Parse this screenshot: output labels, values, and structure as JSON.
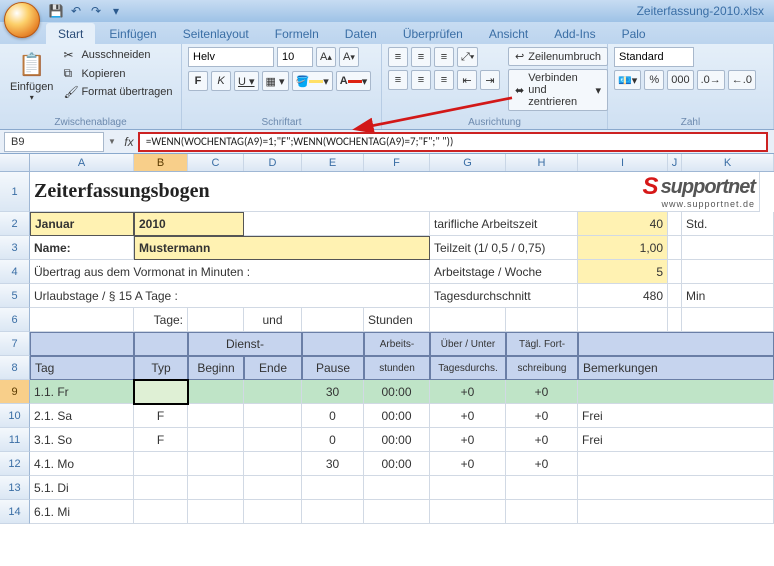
{
  "app": {
    "filename": "Zeiterfassung-2010.xlsx"
  },
  "qat": {
    "save": "save",
    "undo": "undo",
    "redo": "redo"
  },
  "tabs": [
    "Start",
    "Einfügen",
    "Seitenlayout",
    "Formeln",
    "Daten",
    "Überprüfen",
    "Ansicht",
    "Add-Ins",
    "Palo"
  ],
  "ribbon": {
    "paste": "Einfügen",
    "cut": "Ausschneiden",
    "copy": "Kopieren",
    "formatpainter": "Format übertragen",
    "g_clipboard": "Zwischenablage",
    "font_name": "Helv",
    "font_size": "10",
    "g_font": "Schriftart",
    "wrap": "Zeilenumbruch",
    "merge": "Verbinden und zentrieren",
    "g_align": "Ausrichtung",
    "num_format": "Standard",
    "g_number": "Zahl"
  },
  "fbar": {
    "namebox": "B9",
    "formula": "=WENN(WOCHENTAG(A9)=1;\"F\";WENN(WOCHENTAG(A9)=7;\"F\";\" \"))"
  },
  "cols": [
    "A",
    "B",
    "C",
    "D",
    "E",
    "F",
    "G",
    "H",
    "I",
    "J",
    "K"
  ],
  "sheet": {
    "title": "Zeiterfassungsbogen",
    "logo": {
      "word": "supportnet",
      "sub": "www.supportnet.de"
    },
    "month": "Januar",
    "year": "2010",
    "name_label": "Name:",
    "name_value": "Mustermann",
    "tarif_label": "tarifliche Arbeitszeit",
    "tarif_val": "40",
    "tarif_unit": "Std.",
    "teil_label": "Teilzeit (1/ 0,5 / 0,75)",
    "teil_val": "1,00",
    "carry_label": "Übertrag aus dem Vormonat in Minuten :",
    "arbtage_label": "Arbeitstage / Woche",
    "arbtage_val": "5",
    "urlaub_label": "Urlaubstage / § 15 A Tage :",
    "durch_label": "Tagesdurchschnitt",
    "durch_val": "480",
    "durch_unit": "Min",
    "tage_label": "Tage:",
    "und_label": "und",
    "stunden_label": "Stunden",
    "hdr": {
      "tag": "Tag",
      "typ": "Typ",
      "dienst": "Dienst-",
      "beginn": "Beginn",
      "ende": "Ende",
      "pause": "Pause",
      "arbeits": "Arbeits-",
      "stunden": "stunden",
      "ueber": "Über / Unter",
      "tagesd": "Tagesdurchs.",
      "taegl": "Tägl. Fort-",
      "schreib": "schreibung",
      "bem": "Bemerkungen"
    },
    "rows": [
      {
        "n": 9,
        "tag": "1.1. Fr",
        "typ": "",
        "pause": "30",
        "arb": "00:00",
        "ueber": "+0",
        "fort": "+0",
        "bem": ""
      },
      {
        "n": 10,
        "tag": "2.1. Sa",
        "typ": "F",
        "pause": "0",
        "arb": "00:00",
        "ueber": "+0",
        "fort": "+0",
        "bem": "Frei"
      },
      {
        "n": 11,
        "tag": "3.1. So",
        "typ": "F",
        "pause": "0",
        "arb": "00:00",
        "ueber": "+0",
        "fort": "+0",
        "bem": "Frei"
      },
      {
        "n": 12,
        "tag": "4.1. Mo",
        "typ": "",
        "pause": "30",
        "arb": "00:00",
        "ueber": "+0",
        "fort": "+0",
        "bem": ""
      },
      {
        "n": 13,
        "tag": "5.1. Di",
        "typ": "",
        "pause": "",
        "arb": "",
        "ueber": "",
        "fort": "",
        "bem": ""
      },
      {
        "n": 14,
        "tag": "6.1. Mi",
        "typ": "",
        "pause": "",
        "arb": "",
        "ueber": "",
        "fort": "",
        "bem": ""
      }
    ]
  }
}
